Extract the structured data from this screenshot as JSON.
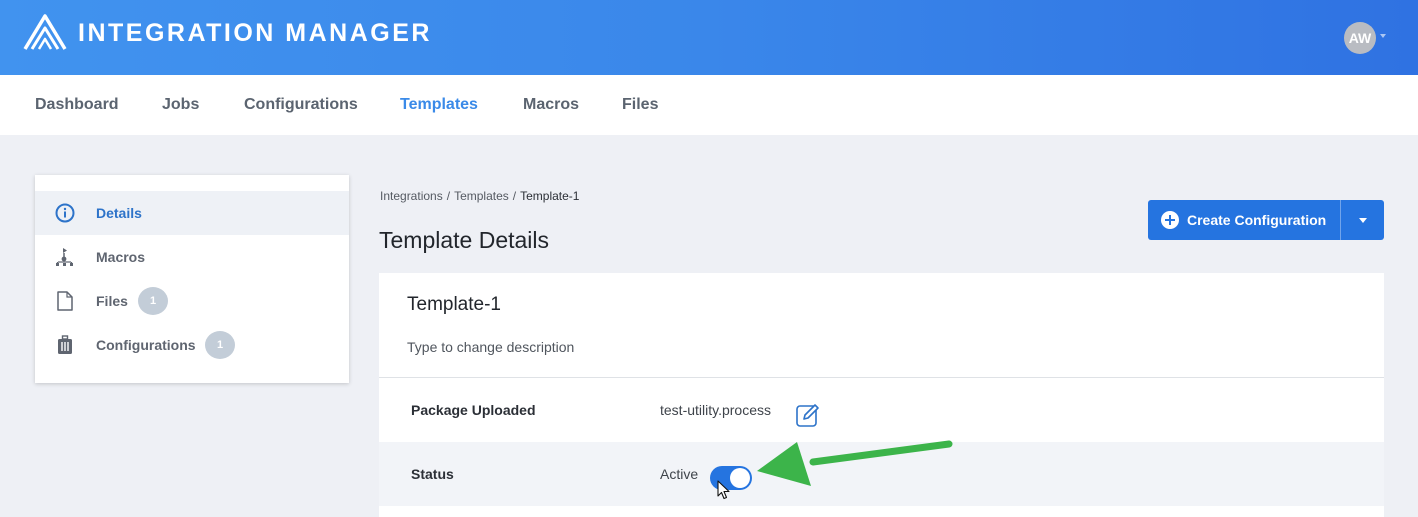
{
  "app": {
    "title": "INTEGRATION MANAGER",
    "user_initials": "AW",
    "brand_color": "#3a87ea"
  },
  "nav": {
    "items": [
      {
        "label": "Dashboard",
        "active": false
      },
      {
        "label": "Jobs",
        "active": false
      },
      {
        "label": "Configurations",
        "active": false
      },
      {
        "label": "Templates",
        "active": true
      },
      {
        "label": "Macros",
        "active": false
      },
      {
        "label": "Files",
        "active": false
      }
    ]
  },
  "sidebar": {
    "items": [
      {
        "label": "Details",
        "icon": "info-icon",
        "active": true
      },
      {
        "label": "Macros",
        "icon": "macro-flow-icon"
      },
      {
        "label": "Files",
        "icon": "file-icon",
        "count": "1"
      },
      {
        "label": "Configurations",
        "icon": "configuration-icon",
        "count": "1"
      }
    ]
  },
  "breadcrumb": {
    "items": [
      "Integrations",
      "Templates"
    ],
    "current": "Template-1"
  },
  "page": {
    "title": "Template Details"
  },
  "actions": {
    "create_label": "Create Configuration",
    "accent": "#2574e0"
  },
  "template": {
    "name": "Template-1",
    "description_placeholder": "Type to change description",
    "package_label": "Package Uploaded",
    "package_value": "test-utility.process",
    "status_label": "Status",
    "status_value": "Active",
    "status_on": true
  },
  "annotation": {
    "arrow_color": "#3cb44a"
  }
}
